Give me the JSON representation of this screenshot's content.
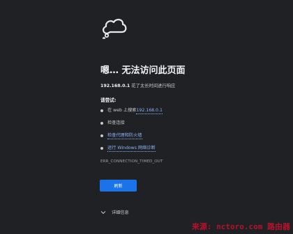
{
  "error_page": {
    "title": "嗯… 无法访问此页面",
    "description_host": "192.168.0.1",
    "description_rest": " 花了太长时间进行响应",
    "try_heading": "请尝试:",
    "suggestions": [
      {
        "prefix": "在 web 上搜索 ",
        "link": "192.168.0.1"
      },
      {
        "prefix": "检查连接",
        "link": ""
      },
      {
        "prefix": "",
        "link": "检查代理和防火墙"
      },
      {
        "prefix": "",
        "link": "运行 Windows 网络诊断"
      }
    ],
    "error_code": "ERR_CONNECTION_TIMED_OUT",
    "reload_label": "刷新",
    "details_label": "详细信息"
  },
  "watermark": "来源: nctoro.com 路由器",
  "icons": {
    "cloud": "cloud-icon",
    "details_chevron": "chevron-down-icon"
  },
  "colors": {
    "background": "#202124",
    "link": "#8ab4f8",
    "button": "#1a73e8",
    "watermark": "#c8102e"
  }
}
